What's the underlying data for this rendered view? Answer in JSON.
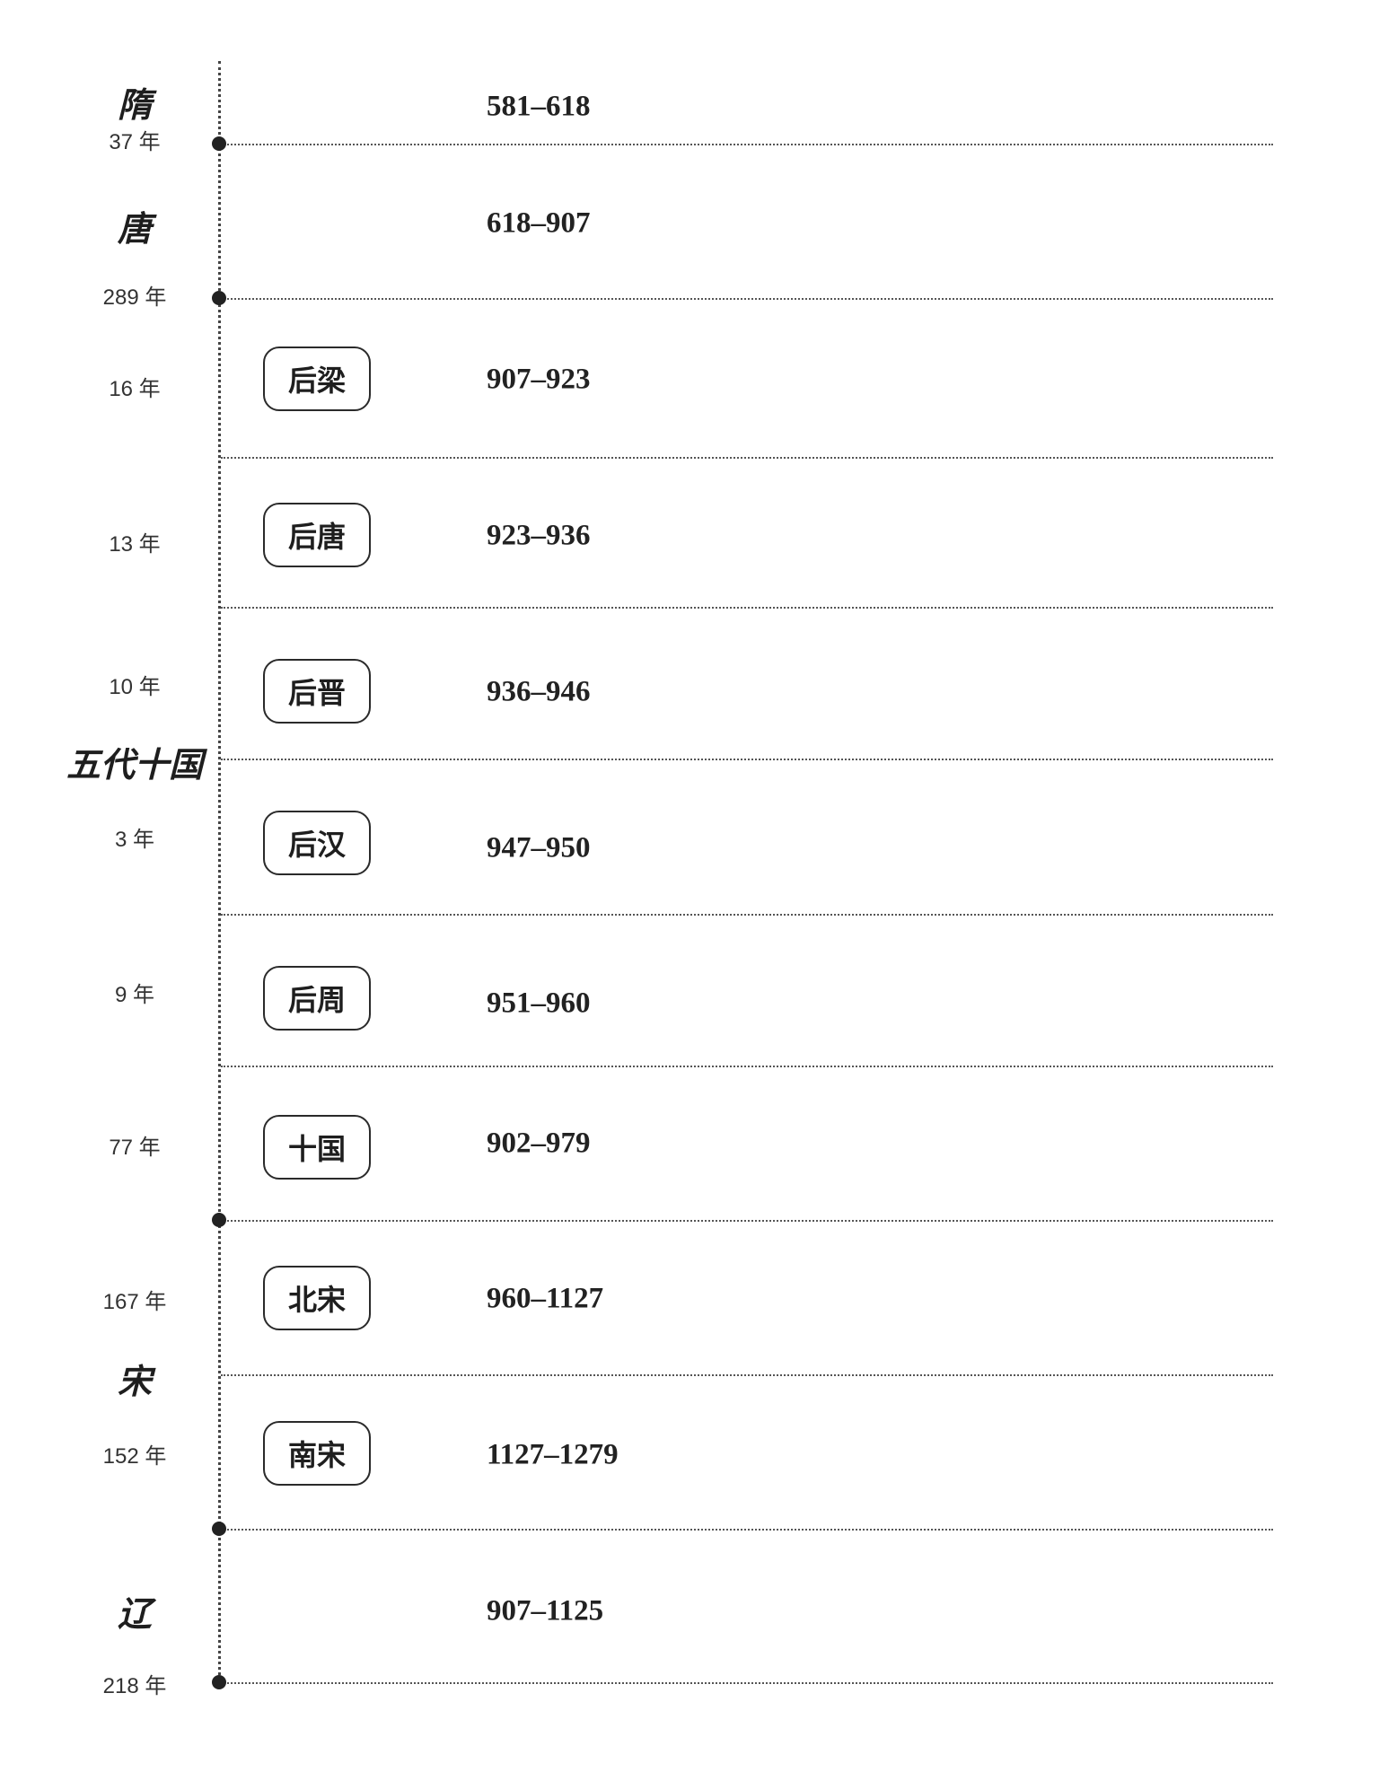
{
  "dynasties": {
    "sui": "隋",
    "tang": "唐",
    "wudai": "五代十国",
    "song": "宋",
    "liao": "辽"
  },
  "durations": {
    "sui": "37 年",
    "tang": "289 年",
    "houliang": "16 年",
    "houtang": "13 年",
    "houjin": "10 年",
    "houhan": "3 年",
    "houzhou": "9 年",
    "shiguo": "77 年",
    "beisong": "167 年",
    "nansong": "152 年",
    "liao": "218 年"
  },
  "subperiods": {
    "houliang": "后梁",
    "houtang": "后唐",
    "houjin": "后晋",
    "houhan": "后汉",
    "houzhou": "后周",
    "shiguo": "十国",
    "beisong": "北宋",
    "nansong": "南宋"
  },
  "years": {
    "sui": "581–618",
    "tang": "618–907",
    "houliang": "907–923",
    "houtang": "923–936",
    "houjin": "936–946",
    "houhan": "947–950",
    "houzhou": "951–960",
    "shiguo": "902–979",
    "beisong": "960–1127",
    "nansong": "1127–1279",
    "liao": "907–1125"
  }
}
